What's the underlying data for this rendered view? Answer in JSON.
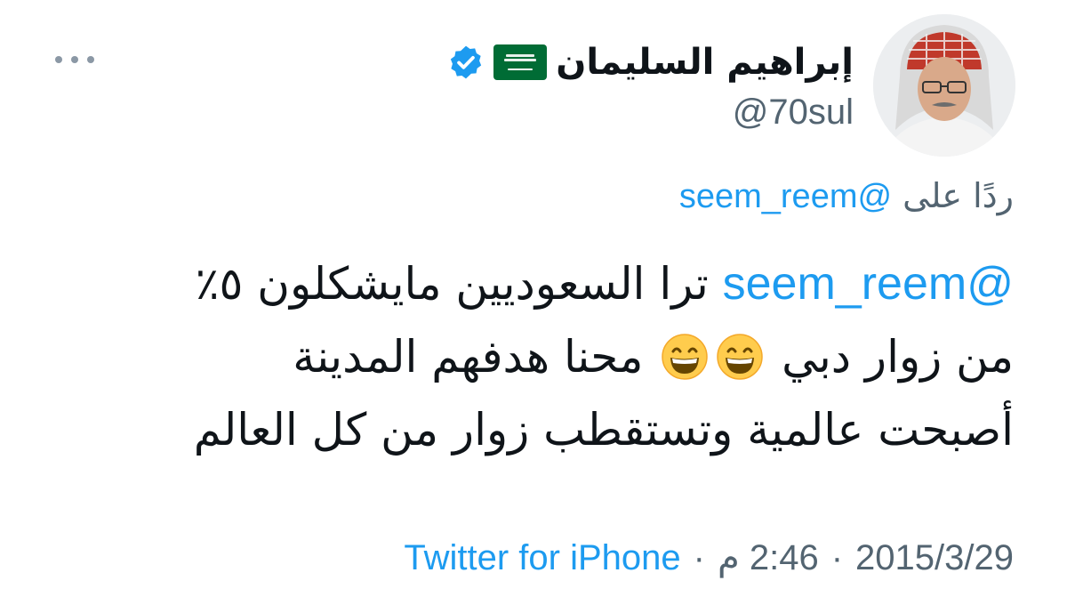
{
  "author": {
    "display_name": "إبراهيم السليمان",
    "handle": "@70sul",
    "verified": true,
    "flag": "saudi-arabia-flag"
  },
  "reply": {
    "prefix": "ردًا على",
    "mention": "@seem_reem"
  },
  "body": {
    "mention": "@seem_reem",
    "line1_text": "ترا السعوديين مايشكلون ٥٪",
    "line2_before_emoji": "من زوار دبي",
    "line2_after_emoji": "محنا هدفهم المدينة",
    "line3": "أصبحت عالمية وتستقطب زوار من كل العالم",
    "emoji": "grinning-smiling-eyes-emoji"
  },
  "meta": {
    "date": "2015/3/29",
    "time": "2:46 م",
    "separator": "·",
    "source": "Twitter for iPhone"
  },
  "colors": {
    "link": "#1d9bf0",
    "secondary": "#536471",
    "primary": "#0f1419",
    "verified": "#1d9bf0",
    "flag_green": "#006c35"
  }
}
